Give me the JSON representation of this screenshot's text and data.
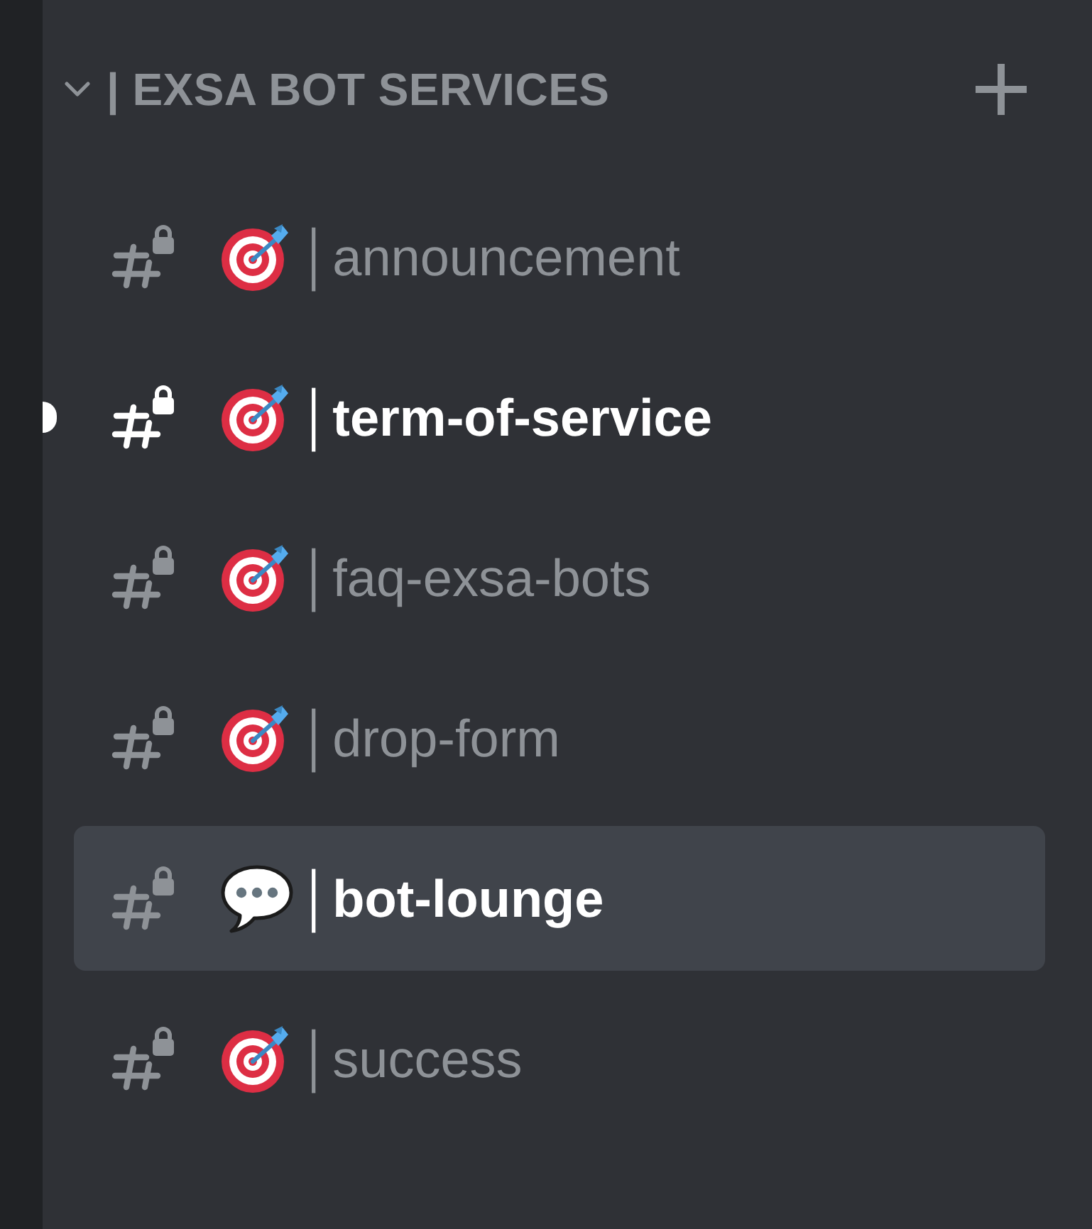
{
  "category": {
    "name": "| EXSA BOT SERVICES",
    "expanded": true
  },
  "channels": [
    {
      "kind": "target",
      "name": "│announcement",
      "unread": false,
      "selected": false
    },
    {
      "kind": "target",
      "name": "│term-of-service",
      "unread": true,
      "selected": false
    },
    {
      "kind": "target",
      "name": "│faq-exsa-bots",
      "unread": false,
      "selected": false
    },
    {
      "kind": "target",
      "name": "│drop-form",
      "unread": false,
      "selected": false
    },
    {
      "kind": "speech",
      "name": "│bot-lounge",
      "unread": false,
      "selected": true
    },
    {
      "kind": "target",
      "name": "│success",
      "unread": false,
      "selected": false
    }
  ]
}
